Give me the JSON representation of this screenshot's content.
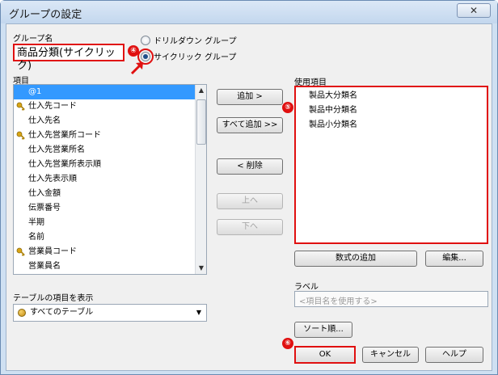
{
  "window": {
    "title": "グループの設定",
    "close_glyph": "✕"
  },
  "group_name": {
    "label": "グループ名",
    "value": "商品分類(サイクリック)"
  },
  "grouping_type": {
    "options": [
      {
        "label": "ドリルダウン グループ",
        "selected": false
      },
      {
        "label": "サイクリック グループ",
        "selected": true
      }
    ]
  },
  "items": {
    "label": "項目",
    "rows": [
      {
        "text": "@1",
        "key": false,
        "selected": true
      },
      {
        "text": "仕入先コード",
        "key": true,
        "selected": false
      },
      {
        "text": "仕入先名",
        "key": false,
        "selected": false
      },
      {
        "text": "仕入先営業所コード",
        "key": true,
        "selected": false
      },
      {
        "text": "仕入先営業所名",
        "key": false,
        "selected": false
      },
      {
        "text": "仕入先営業所表示順",
        "key": false,
        "selected": false
      },
      {
        "text": "仕入先表示順",
        "key": false,
        "selected": false
      },
      {
        "text": "仕入金額",
        "key": false,
        "selected": false
      },
      {
        "text": "伝票番号",
        "key": false,
        "selected": false
      },
      {
        "text": "半期",
        "key": false,
        "selected": false
      },
      {
        "text": "名前",
        "key": false,
        "selected": false
      },
      {
        "text": "営業員コード",
        "key": true,
        "selected": false
      },
      {
        "text": "営業員名",
        "key": false,
        "selected": false
      }
    ]
  },
  "buttons": {
    "add": "追加 >",
    "add_all": "すべて追加 >>",
    "remove": "< 削除",
    "up": "上へ",
    "down": "下へ",
    "add_formula": "数式の追加",
    "edit": "編集...",
    "sort_order": "ソート順...",
    "ok": "OK",
    "cancel": "キャンセル",
    "help": "ヘルプ"
  },
  "used_items": {
    "label": "使用項目",
    "rows": [
      "製品大分類名",
      "製品中分類名",
      "製品小分類名"
    ]
  },
  "table_filter": {
    "label": "テーブルの項目を表示",
    "value": "すべてのテーブル"
  },
  "label_field": {
    "label": "ラベル",
    "placeholder": "<項目名を使用する>"
  },
  "annotations": {
    "badge_4": "④",
    "badge_5": "⑤",
    "badge_6": "⑥"
  },
  "colors": {
    "highlight_red": "#e01010",
    "selection_blue": "#3399ff"
  }
}
